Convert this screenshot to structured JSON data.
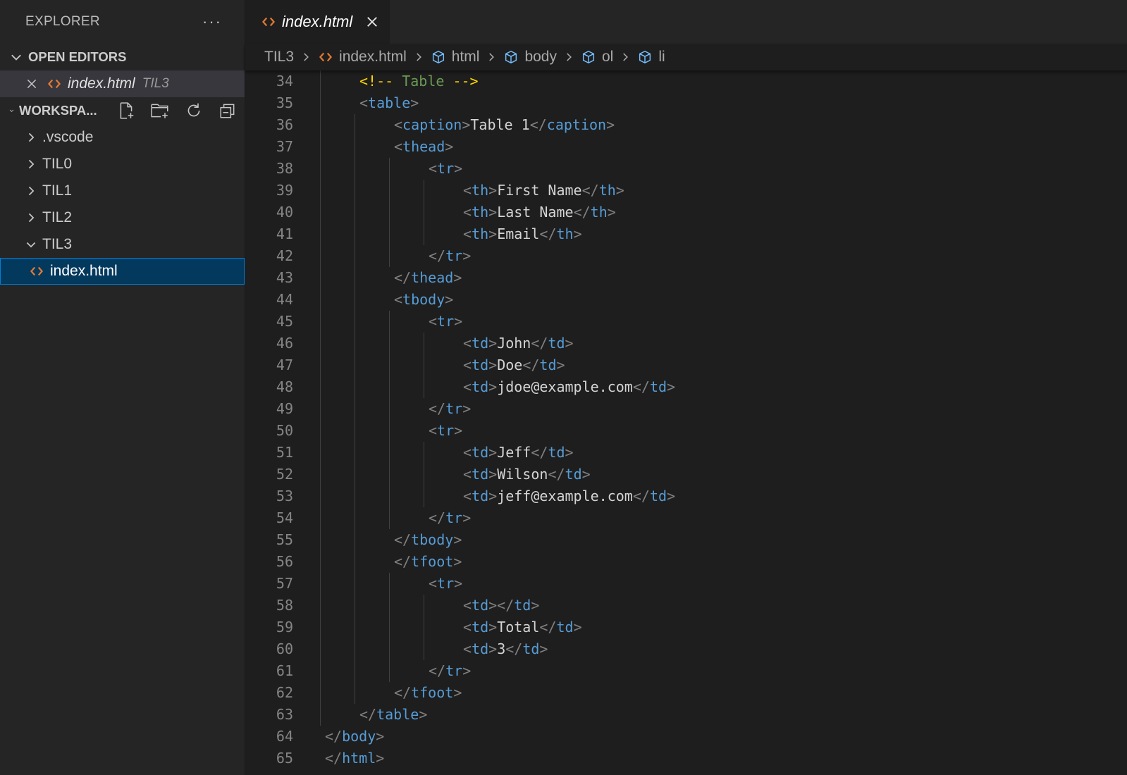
{
  "explorer": {
    "title": "EXPLORER",
    "more": "···",
    "open_editors": {
      "label": "OPEN EDITORS",
      "file": "index.html",
      "folder": "TIL3"
    },
    "workspace": {
      "label": "WORKSPA...",
      "items": [
        {
          "label": ".vscode"
        },
        {
          "label": "TIL0"
        },
        {
          "label": "TIL1"
        },
        {
          "label": "TIL2"
        },
        {
          "label": "TIL3"
        }
      ],
      "selected_file": "index.html"
    }
  },
  "tab": {
    "label": "index.html"
  },
  "breadcrumb": {
    "folder": "TIL3",
    "file": "index.html",
    "symbols": [
      "html",
      "body",
      "ol",
      "li"
    ]
  },
  "colors": {
    "accent": "#007fd4",
    "html_icon": "#e37933",
    "symbol_icon": "#75beff"
  },
  "editor": {
    "lines": [
      {
        "n": "34",
        "i": 2,
        "k": [
          [
            "y",
            "<!-- "
          ],
          [
            "c",
            "Table"
          ],
          [
            "y",
            " -->"
          ]
        ]
      },
      {
        "n": "35",
        "i": 2,
        "k": [
          [
            "b",
            "<"
          ],
          [
            "t",
            "table"
          ],
          [
            "b",
            ">"
          ]
        ]
      },
      {
        "n": "36",
        "i": 3,
        "k": [
          [
            "b",
            "<"
          ],
          [
            "t",
            "caption"
          ],
          [
            "b",
            ">"
          ],
          [
            "p",
            "Table 1"
          ],
          [
            "b",
            "</"
          ],
          [
            "t",
            "caption"
          ],
          [
            "b",
            ">"
          ]
        ]
      },
      {
        "n": "37",
        "i": 3,
        "k": [
          [
            "b",
            "<"
          ],
          [
            "t",
            "thead"
          ],
          [
            "b",
            ">"
          ]
        ]
      },
      {
        "n": "38",
        "i": 4,
        "k": [
          [
            "b",
            "<"
          ],
          [
            "t",
            "tr"
          ],
          [
            "b",
            ">"
          ]
        ]
      },
      {
        "n": "39",
        "i": 5,
        "k": [
          [
            "b",
            "<"
          ],
          [
            "t",
            "th"
          ],
          [
            "b",
            ">"
          ],
          [
            "p",
            "First Name"
          ],
          [
            "b",
            "</"
          ],
          [
            "t",
            "th"
          ],
          [
            "b",
            ">"
          ]
        ]
      },
      {
        "n": "40",
        "i": 5,
        "k": [
          [
            "b",
            "<"
          ],
          [
            "t",
            "th"
          ],
          [
            "b",
            ">"
          ],
          [
            "p",
            "Last Name"
          ],
          [
            "b",
            "</"
          ],
          [
            "t",
            "th"
          ],
          [
            "b",
            ">"
          ]
        ]
      },
      {
        "n": "41",
        "i": 5,
        "k": [
          [
            "b",
            "<"
          ],
          [
            "t",
            "th"
          ],
          [
            "b",
            ">"
          ],
          [
            "p",
            "Email"
          ],
          [
            "b",
            "</"
          ],
          [
            "t",
            "th"
          ],
          [
            "b",
            ">"
          ]
        ]
      },
      {
        "n": "42",
        "i": 4,
        "k": [
          [
            "b",
            "</"
          ],
          [
            "t",
            "tr"
          ],
          [
            "b",
            ">"
          ]
        ]
      },
      {
        "n": "43",
        "i": 3,
        "k": [
          [
            "b",
            "</"
          ],
          [
            "t",
            "thead"
          ],
          [
            "b",
            ">"
          ]
        ]
      },
      {
        "n": "44",
        "i": 3,
        "k": [
          [
            "b",
            "<"
          ],
          [
            "t",
            "tbody"
          ],
          [
            "b",
            ">"
          ]
        ]
      },
      {
        "n": "45",
        "i": 4,
        "k": [
          [
            "b",
            "<"
          ],
          [
            "t",
            "tr"
          ],
          [
            "b",
            ">"
          ]
        ]
      },
      {
        "n": "46",
        "i": 5,
        "k": [
          [
            "b",
            "<"
          ],
          [
            "t",
            "td"
          ],
          [
            "b",
            ">"
          ],
          [
            "p",
            "John"
          ],
          [
            "b",
            "</"
          ],
          [
            "t",
            "td"
          ],
          [
            "b",
            ">"
          ]
        ]
      },
      {
        "n": "47",
        "i": 5,
        "k": [
          [
            "b",
            "<"
          ],
          [
            "t",
            "td"
          ],
          [
            "b",
            ">"
          ],
          [
            "p",
            "Doe"
          ],
          [
            "b",
            "</"
          ],
          [
            "t",
            "td"
          ],
          [
            "b",
            ">"
          ]
        ]
      },
      {
        "n": "48",
        "i": 5,
        "k": [
          [
            "b",
            "<"
          ],
          [
            "t",
            "td"
          ],
          [
            "b",
            ">"
          ],
          [
            "p",
            "jdoe@example.com"
          ],
          [
            "b",
            "</"
          ],
          [
            "t",
            "td"
          ],
          [
            "b",
            ">"
          ]
        ]
      },
      {
        "n": "49",
        "i": 4,
        "k": [
          [
            "b",
            "</"
          ],
          [
            "t",
            "tr"
          ],
          [
            "b",
            ">"
          ]
        ]
      },
      {
        "n": "50",
        "i": 4,
        "k": [
          [
            "b",
            "<"
          ],
          [
            "t",
            "tr"
          ],
          [
            "b",
            ">"
          ]
        ]
      },
      {
        "n": "51",
        "i": 5,
        "k": [
          [
            "b",
            "<"
          ],
          [
            "t",
            "td"
          ],
          [
            "b",
            ">"
          ],
          [
            "p",
            "Jeff"
          ],
          [
            "b",
            "</"
          ],
          [
            "t",
            "td"
          ],
          [
            "b",
            ">"
          ]
        ]
      },
      {
        "n": "52",
        "i": 5,
        "k": [
          [
            "b",
            "<"
          ],
          [
            "t",
            "td"
          ],
          [
            "b",
            ">"
          ],
          [
            "p",
            "Wilson"
          ],
          [
            "b",
            "</"
          ],
          [
            "t",
            "td"
          ],
          [
            "b",
            ">"
          ]
        ]
      },
      {
        "n": "53",
        "i": 5,
        "k": [
          [
            "b",
            "<"
          ],
          [
            "t",
            "td"
          ],
          [
            "b",
            ">"
          ],
          [
            "p",
            "jeff@example.com"
          ],
          [
            "b",
            "</"
          ],
          [
            "t",
            "td"
          ],
          [
            "b",
            ">"
          ]
        ]
      },
      {
        "n": "54",
        "i": 4,
        "k": [
          [
            "b",
            "</"
          ],
          [
            "t",
            "tr"
          ],
          [
            "b",
            ">"
          ]
        ]
      },
      {
        "n": "55",
        "i": 3,
        "k": [
          [
            "b",
            "</"
          ],
          [
            "t",
            "tbody"
          ],
          [
            "b",
            ">"
          ]
        ]
      },
      {
        "n": "56",
        "i": 3,
        "k": [
          [
            "b",
            "</"
          ],
          [
            "t",
            "tfoot"
          ],
          [
            "b",
            ">"
          ]
        ]
      },
      {
        "n": "57",
        "i": 4,
        "k": [
          [
            "b",
            "<"
          ],
          [
            "t",
            "tr"
          ],
          [
            "b",
            ">"
          ]
        ]
      },
      {
        "n": "58",
        "i": 5,
        "k": [
          [
            "b",
            "<"
          ],
          [
            "t",
            "td"
          ],
          [
            "b",
            "></"
          ],
          [
            "t",
            "td"
          ],
          [
            "b",
            ">"
          ]
        ]
      },
      {
        "n": "59",
        "i": 5,
        "k": [
          [
            "b",
            "<"
          ],
          [
            "t",
            "td"
          ],
          [
            "b",
            ">"
          ],
          [
            "p",
            "Total"
          ],
          [
            "b",
            "</"
          ],
          [
            "t",
            "td"
          ],
          [
            "b",
            ">"
          ]
        ]
      },
      {
        "n": "60",
        "i": 5,
        "k": [
          [
            "b",
            "<"
          ],
          [
            "t",
            "td"
          ],
          [
            "b",
            ">"
          ],
          [
            "p",
            "3"
          ],
          [
            "b",
            "</"
          ],
          [
            "t",
            "td"
          ],
          [
            "b",
            ">"
          ]
        ]
      },
      {
        "n": "61",
        "i": 4,
        "k": [
          [
            "b",
            "</"
          ],
          [
            "t",
            "tr"
          ],
          [
            "b",
            ">"
          ]
        ]
      },
      {
        "n": "62",
        "i": 3,
        "k": [
          [
            "b",
            "</"
          ],
          [
            "t",
            "tfoot"
          ],
          [
            "b",
            ">"
          ]
        ]
      },
      {
        "n": "63",
        "i": 2,
        "k": [
          [
            "b",
            "</"
          ],
          [
            "t",
            "table"
          ],
          [
            "b",
            ">"
          ]
        ]
      },
      {
        "n": "64",
        "i": 1,
        "k": [
          [
            "b",
            "</"
          ],
          [
            "t",
            "body"
          ],
          [
            "b",
            ">"
          ]
        ]
      },
      {
        "n": "65",
        "i": 1,
        "k": [
          [
            "b",
            "</"
          ],
          [
            "t",
            "html"
          ],
          [
            "b",
            ">"
          ]
        ]
      }
    ]
  }
}
